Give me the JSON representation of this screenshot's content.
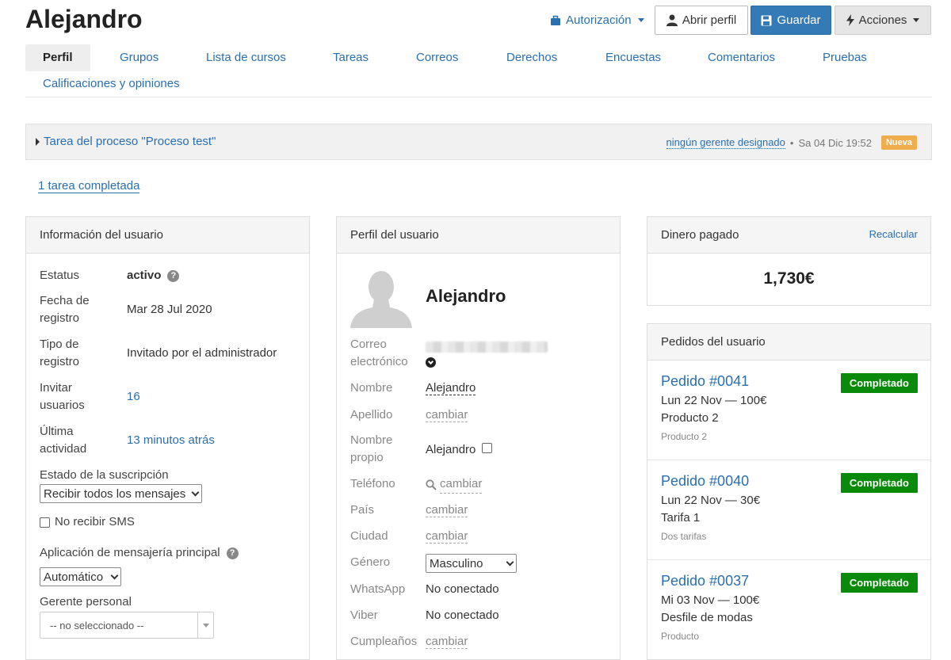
{
  "header": {
    "title": "Alejandro",
    "auth_label": "Autorización",
    "open_profile_label": "Abrir perfil",
    "save_label": "Guardar",
    "actions_label": "Acciones"
  },
  "tabs": [
    {
      "label": "Perfil",
      "active": true
    },
    {
      "label": "Grupos"
    },
    {
      "label": "Lista de cursos"
    },
    {
      "label": "Tareas"
    },
    {
      "label": "Correos"
    },
    {
      "label": "Derechos"
    },
    {
      "label": "Encuestas"
    },
    {
      "label": "Comentarios"
    },
    {
      "label": "Pruebas"
    },
    {
      "label": "Calificaciones y opiniones"
    }
  ],
  "task": {
    "title": "Tarea del proceso \"Proceso test\"",
    "manager": "ningún gerente designado",
    "separator": "•",
    "datetime": "Sa 04 Dic 19:52",
    "badge": "Nueva"
  },
  "completed_tasks_link": "1 tarea completada",
  "user_info": {
    "heading": "Información del usuario",
    "status_label": "Estatus",
    "status_value": "activo",
    "reg_date_label_1": "Fecha de",
    "reg_date_label_2": "registro",
    "reg_date_value": "Mar 28 Jul 2020",
    "reg_type_label_1": "Tipo de",
    "reg_type_label_2": "registro",
    "reg_type_value": "Invitado por el administrador",
    "invite_label_1": "Invitar",
    "invite_label_2": "usuarios",
    "invite_value": "16",
    "last_activity_label_1": "Última",
    "last_activity_label_2": "actividad",
    "last_activity_value": "13 minutos atrás",
    "subscription_label": "Estado de la suscripción",
    "subscription_value": "Recibir todos los mensajes",
    "no_sms_label": "No recibir SMS",
    "messenger_label": "Aplicación de mensajería principal",
    "messenger_value": "Automático",
    "manager_label": "Gerente personal",
    "manager_value": "-- no seleccionado --"
  },
  "user_profile": {
    "heading": "Perfil del usuario",
    "name": "Alejandro",
    "email_label_1": "Correo",
    "email_label_2": "electrónico",
    "first_name_label": "Nombre",
    "first_name_value": "Alejandro",
    "last_name_label": "Apellido",
    "change": "cambiar",
    "own_name_label_1": "Nombre",
    "own_name_label_2": "propio",
    "own_name_value": "Alejandro",
    "phone_label": "Teléfono",
    "country_label": "País",
    "city_label": "Ciudad",
    "gender_label": "Género",
    "gender_value": "Masculino",
    "whatsapp_label": "WhatsApp",
    "whatsapp_value": "No conectado",
    "viber_label": "Viber",
    "viber_value": "No conectado",
    "birthday_label": "Cumpleaños"
  },
  "money": {
    "heading": "Dinero pagado",
    "recalc": "Recalcular",
    "amount": "1,730€"
  },
  "orders": {
    "heading": "Pedidos del usuario",
    "items": [
      {
        "title": "Pedido #0041",
        "date": "Lun 22 Nov — 100€",
        "product": "Producto 2",
        "sub": "Producto 2",
        "status": "Completado"
      },
      {
        "title": "Pedido #0040",
        "date": "Lun 22 Nov — 30€",
        "product": "Tarifa 1",
        "sub": "Dos tarifas",
        "status": "Completado"
      },
      {
        "title": "Pedido #0037",
        "date": "Mi 03 Nov — 100€",
        "product": "Desfile de modas",
        "sub": "Producto",
        "status": "Completado"
      }
    ]
  },
  "colors": {
    "link": "#2a6fb0",
    "save_button": "#337ab7",
    "badge_new": "#f0ad4e",
    "badge_completed": "#0a8a0a"
  }
}
